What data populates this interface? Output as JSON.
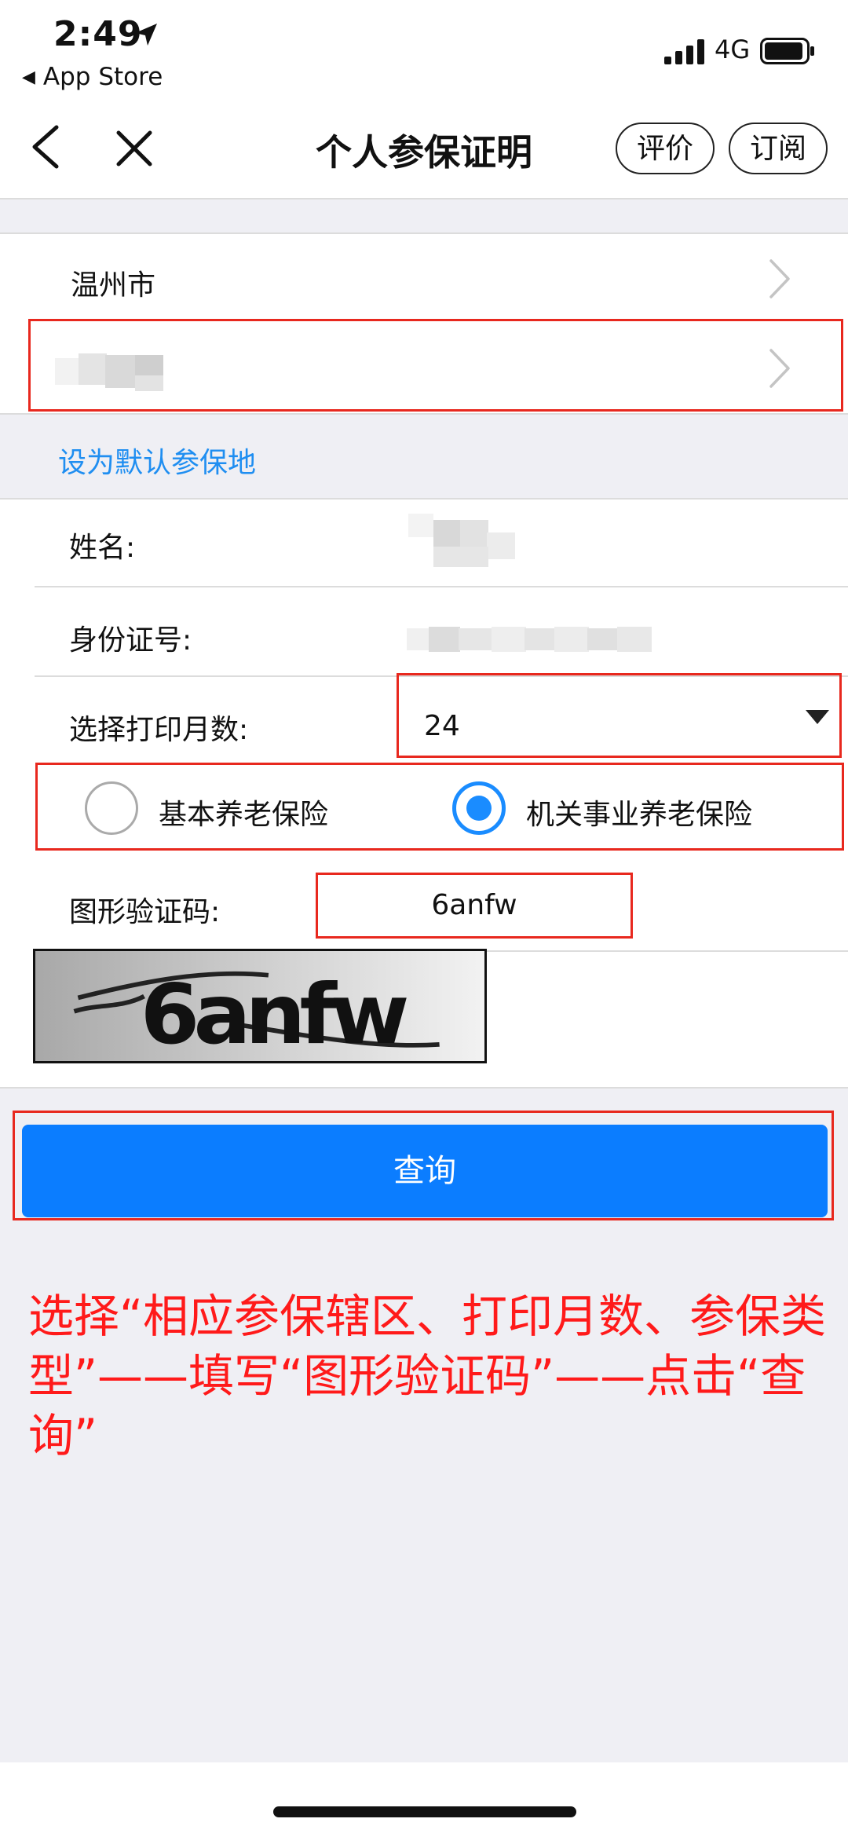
{
  "status_bar": {
    "time": "2:49",
    "back_app": "App Store",
    "network": "4G"
  },
  "nav": {
    "title": "个人参保证明",
    "rate_label": "评价",
    "subscribe_label": "订阅"
  },
  "location": {
    "city": "温州市",
    "set_default_label": "设为默认参保地"
  },
  "form": {
    "name_label": "姓名:",
    "id_label": "身份证号:",
    "months_label": "选择打印月数:",
    "months_value": "24",
    "insurance_types": [
      {
        "label": "基本养老保险",
        "selected": false
      },
      {
        "label": "机关事业养老保险",
        "selected": true
      }
    ],
    "captcha_label": "图形验证码:",
    "captcha_value": "6anfw",
    "captcha_image_text": "6anfw"
  },
  "query_button": "查询",
  "instruction": "选择“相应参保辖区、打印月数、参保类型”——填写“图形验证码”——点击“查询”",
  "colors": {
    "accent": "#0b7dff",
    "link": "#1f8ef1",
    "annotation": "#e8281e"
  }
}
